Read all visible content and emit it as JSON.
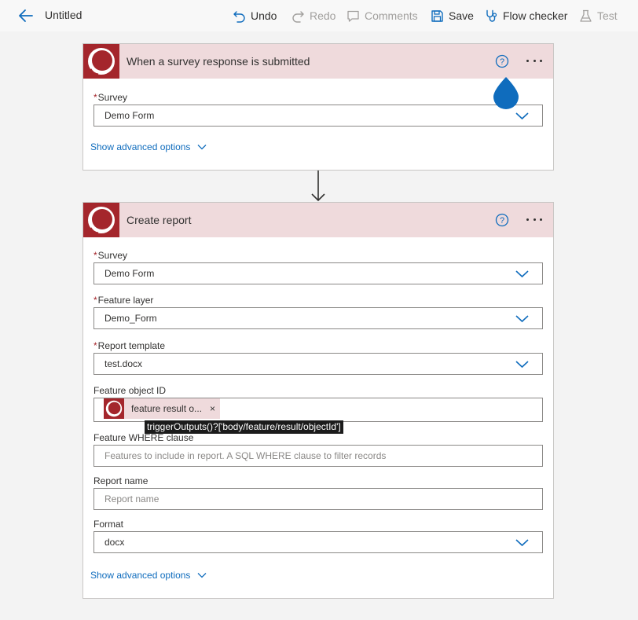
{
  "header": {
    "title": "Untitled",
    "undo": "Undo",
    "redo": "Redo",
    "comments": "Comments",
    "save": "Save",
    "flow_checker": "Flow checker",
    "test": "Test"
  },
  "trigger": {
    "title": "When a survey response is submitted",
    "survey_label": "Survey",
    "survey_value": "Demo Form",
    "advanced": "Show advanced options"
  },
  "action": {
    "title": "Create report",
    "survey_label": "Survey",
    "survey_value": "Demo Form",
    "feature_layer_label": "Feature layer",
    "feature_layer_value": "Demo_Form",
    "report_template_label": "Report template",
    "report_template_value": "test.docx",
    "feature_object_id_label": "Feature object ID",
    "token_text": "feature result o...",
    "token_remove": "×",
    "tooltip": "triggerOutputs()?['body/feature/result/objectId']",
    "where_label": "Feature WHERE clause",
    "where_placeholder": "Features to include in report. A SQL WHERE clause to filter records",
    "report_name_label": "Report name",
    "report_name_placeholder": "Report name",
    "format_label": "Format",
    "format_value": "docx",
    "advanced": "Show advanced options"
  },
  "required_marker": "*",
  "colors": {
    "brand": "#a4262c",
    "header_tint": "#efdadc",
    "link": "#0f6cbd",
    "accent": "#0f6cbd"
  },
  "icons": [
    "back-arrow-icon",
    "undo-icon",
    "redo-icon",
    "comments-icon",
    "save-icon",
    "stethoscope-icon",
    "beaker-icon",
    "help-icon",
    "more-icon",
    "chevron-down-icon",
    "arrow-down-icon"
  ]
}
